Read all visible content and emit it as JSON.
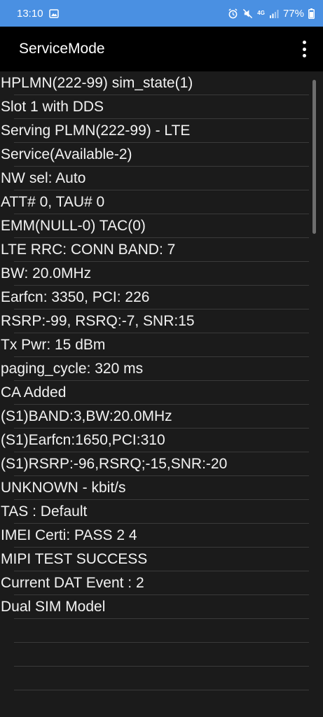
{
  "status_bar": {
    "time": "13:10",
    "battery": "77%",
    "network_label": "4G",
    "background_color": "#4a90e2"
  },
  "app_bar": {
    "title": "ServiceMode",
    "menu_icon": "more-vert-icon"
  },
  "info_lines": [
    "HPLMN(222-99)  sim_state(1)",
    "Slot 1 with DDS",
    "Serving PLMN(222-99) - LTE",
    "Service(Available-2)",
    "NW sel: Auto",
    "ATT# 0, TAU# 0",
    "EMM(NULL-0) TAC(0)",
    "LTE RRC: CONN BAND: 7",
    "BW: 20.0MHz",
    "Earfcn: 3350, PCI: 226",
    "RSRP:-99, RSRQ:-7, SNR:15",
    "Tx Pwr: 15 dBm",
    "paging_cycle: 320 ms",
    "CA Added",
    "(S1)BAND:3,BW:20.0MHz",
    "(S1)Earfcn:1650,PCI:310",
    "(S1)RSRP:-96,RSRQ;-15,SNR:-20",
    "UNKNOWN - kbit/s",
    "TAS : Default",
    "IMEI Certi: PASS 2 4",
    "MIPI TEST SUCCESS",
    "Current DAT Event : 2",
    "Dual SIM Model"
  ]
}
